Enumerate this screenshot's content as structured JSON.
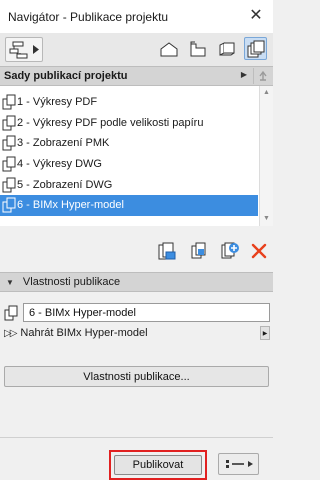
{
  "window": {
    "title": "Navigátor - Publikace projektu",
    "close_glyph": "✕"
  },
  "toolbar": {
    "icons": [
      "navigator-popup-icon",
      "project-map-icon",
      "view-map-icon",
      "layout-book-icon",
      "publisher-sets-icon"
    ],
    "active": "publisher-sets-icon"
  },
  "sets_header": {
    "label": "Sady publikací projektu"
  },
  "sets": {
    "items": [
      {
        "label": "1 - Výkresy PDF"
      },
      {
        "label": "2 - Výkresy PDF podle velikosti papíru"
      },
      {
        "label": "3 - Zobrazení PMK"
      },
      {
        "label": "4 - Výkresy DWG"
      },
      {
        "label": "5 - Zobrazení DWG"
      },
      {
        "label": "6 - BIMx Hyper-model"
      }
    ],
    "selected_index": 5
  },
  "actions": {
    "icons": [
      "new-set-icon",
      "duplicate-set-icon",
      "add-item-icon",
      "delete-icon"
    ],
    "delete_color": "#e8401c"
  },
  "properties": {
    "header": "Vlastnosti publikace",
    "name_value": "6 - BIMx Hyper-model",
    "upload_label": "Nahrát BIMx Hyper-model",
    "button_label": "Vlastnosti publikace..."
  },
  "footer": {
    "publish_label": "Publikovat",
    "highlight_color": "#e12020"
  },
  "colors": {
    "selection": "#3c8de0",
    "header_bg": "#d4d4d4"
  }
}
